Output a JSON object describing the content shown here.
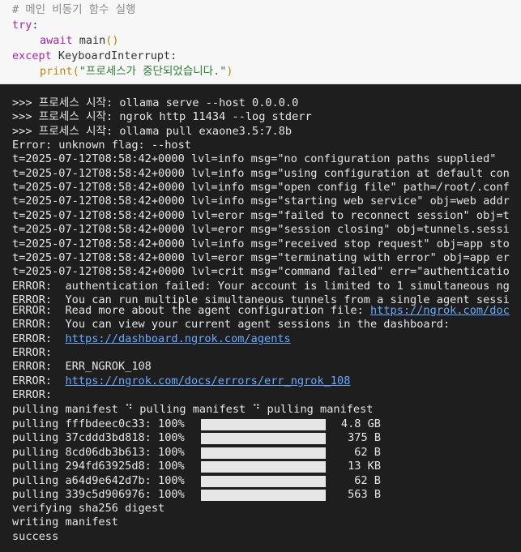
{
  "code": {
    "comment": "# 메인 비동기 함수 실행",
    "try_kw": "try",
    "colon": ":",
    "await_kw": "await",
    "main_call": "main",
    "parens": "()",
    "except_kw": "except",
    "exception_name": "KeyboardInterrupt",
    "print_fn": "print",
    "open_paren": "(",
    "print_arg": "\"프로세스가 중단되었습니다.\"",
    "close_paren": ")"
  },
  "output": {
    "log_lines": [
      ">>> 프로세스 시작: ollama serve --host 0.0.0.0",
      ">>> 프로세스 시작: ngrok http 11434 --log stderr",
      ">>> 프로세스 시작: ollama pull exaone3.5:7.8b",
      "Error: unknown flag: --host",
      "t=2025-07-12T08:58:42+0000 lvl=info msg=\"no configuration paths supplied\"",
      "t=2025-07-12T08:58:42+0000 lvl=info msg=\"using configuration at default con",
      "t=2025-07-12T08:58:42+0000 lvl=info msg=\"open config file\" path=/root/.conf",
      "t=2025-07-12T08:58:42+0000 lvl=info msg=\"starting web service\" obj=web addr",
      "t=2025-07-12T08:58:42+0000 lvl=eror msg=\"failed to reconnect session\" obj=t",
      "t=2025-07-12T08:58:42+0000 lvl=eror msg=\"session closing\" obj=tunnels.sessi",
      "t=2025-07-12T08:58:42+0000 lvl=info msg=\"received stop request\" obj=app sto",
      "t=2025-07-12T08:58:42+0000 lvl=eror msg=\"terminating with error\" obj=app er",
      "t=2025-07-12T08:58:42+0000 lvl=crit msg=\"command failed\" err=\"authenticatio",
      "ERROR:  authentication failed: Your account is limited to 1 simultaneous ng",
      "ERROR:  You can run multiple simultaneous tunnels from a single agent sessi"
    ],
    "read_more_prefix": "ERROR:  Read more about the agent configuration file: ",
    "read_more_link": "https://ngrok.com/doc",
    "view_sessions": "ERROR:  You can view your current agent sessions in the dashboard:",
    "error_prefix": "ERROR:  ",
    "dashboard_link": "https://dashboard.ngrok.com/agents",
    "error_blank": "ERROR:",
    "error_code_line": "ERROR:  ERR_NGROK_108",
    "err_doc_link": "https://ngrok.com/docs/errors/err_ngrok_108",
    "pulling_manifest": "pulling manifest ⠙ pulling manifest ⠙ pulling manifest",
    "pulls": [
      {
        "label": "pulling fffbdeec0c33: 100%",
        "size": "4.8 GB",
        "progress": 1.0
      },
      {
        "label": "pulling 37cddd3bd818: 100%",
        "size": "375 B",
        "progress": 1.0
      },
      {
        "label": "pulling 8cd06db3b613: 100%",
        "size": "62 B",
        "progress": 1.0
      },
      {
        "label": "pulling 294fd63925d8: 100%",
        "size": "13 KB",
        "progress": 1.0
      },
      {
        "label": "pulling a64d9e642d7b: 100%",
        "size": "62 B",
        "progress": 1.0
      },
      {
        "label": "pulling 339c5d906976: 100%",
        "size": "563 B",
        "progress": 1.0
      }
    ],
    "verifying": "verifying sha256 digest",
    "writing": "writing manifest",
    "success": "success"
  }
}
